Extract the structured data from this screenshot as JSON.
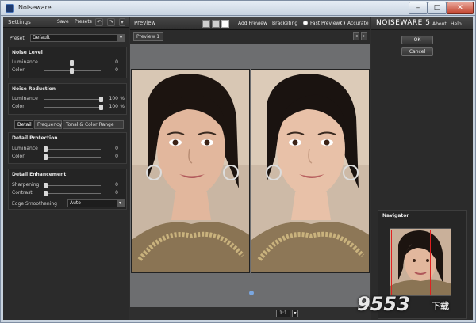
{
  "window": {
    "title": "Noiseware",
    "min": "–",
    "max": "□",
    "close": "✕"
  },
  "settings": {
    "title": "Settings",
    "save": "Save",
    "presets": "Presets",
    "undo": "↶",
    "redo": "↷",
    "preset_label": "Preset",
    "preset_value": "Default",
    "noise_level": {
      "title": "Noise Level",
      "rows": [
        {
          "label": "Luminance",
          "value": "0"
        },
        {
          "label": "Color",
          "value": "0"
        }
      ]
    },
    "noise_reduction": {
      "title": "Noise Reduction",
      "rows": [
        {
          "label": "Luminance",
          "value": "100",
          "unit": "%"
        },
        {
          "label": "Color",
          "value": "100",
          "unit": "%"
        }
      ]
    },
    "tabs": [
      "Detail",
      "Frequency",
      "Tonal & Color Range"
    ],
    "detail_protection": {
      "title": "Detail Protection",
      "rows": [
        {
          "label": "Luminance",
          "value": "0"
        },
        {
          "label": "Color",
          "value": "0"
        }
      ]
    },
    "detail_enhancement": {
      "title": "Detail Enhancement",
      "rows": [
        {
          "label": "Sharpening",
          "value": "0"
        },
        {
          "label": "Contrast",
          "value": "0"
        }
      ],
      "edge_label": "Edge Smoothening",
      "edge_value": "Auto"
    }
  },
  "preview": {
    "title": "Preview",
    "add_preview": "Add Preview",
    "bracketing": "Bracketing",
    "fast_preview": "Fast Preview",
    "accurate": "Accurate",
    "tab": "Preview 1",
    "prev": "◂",
    "next": "▸",
    "zoom": "1:1",
    "zoom_arrow": "▾"
  },
  "right": {
    "brand": "NOISEWARE 5",
    "about": "About",
    "help": "Help",
    "ok": "OK",
    "cancel": "Cancel",
    "navigator": "Navigator"
  },
  "watermark": {
    "text": "9553",
    "suffix": "下载"
  }
}
